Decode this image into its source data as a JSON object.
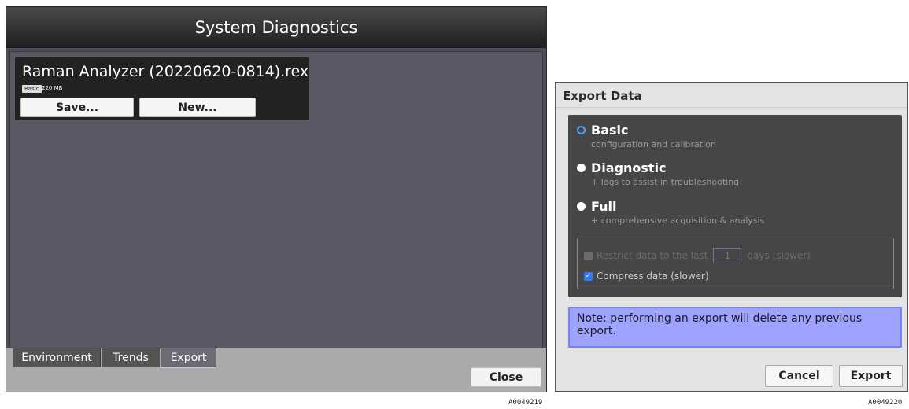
{
  "diagnostics": {
    "title": "System Diagnostics",
    "file": {
      "name": "Raman Analyzer (20220620-0814).rex",
      "badge": "Basic",
      "size": "220 MB"
    },
    "save_label": "Save...",
    "new_label": "New...",
    "tabs": [
      "Environment",
      "Trends",
      "Export"
    ],
    "active_tab": "Export",
    "close_label": "Close"
  },
  "export_dialog": {
    "title": "Export Data",
    "options": [
      {
        "label": "Basic",
        "desc": "configuration and calibration",
        "selected": true
      },
      {
        "label": "Diagnostic",
        "desc": "+ logs to assist in troubleshooting",
        "selected": false
      },
      {
        "label": "Full",
        "desc": "+ comprehensive acquisition & analysis",
        "selected": false
      }
    ],
    "restrict": {
      "prefix": "Restrict data to the last",
      "days": "1",
      "suffix": "days (slower)",
      "checked": false,
      "enabled": false
    },
    "compress": {
      "label": "Compress data (slower)",
      "checked": true
    },
    "note": "Note: performing an export will delete any previous export.",
    "cancel_label": "Cancel",
    "export_label": "Export"
  },
  "captions": [
    "A0049219",
    "A0049220"
  ],
  "colors": {
    "window_bg": "#4f4d58",
    "note_bg": "#9ea3ff",
    "accent": "#2f7df6"
  }
}
